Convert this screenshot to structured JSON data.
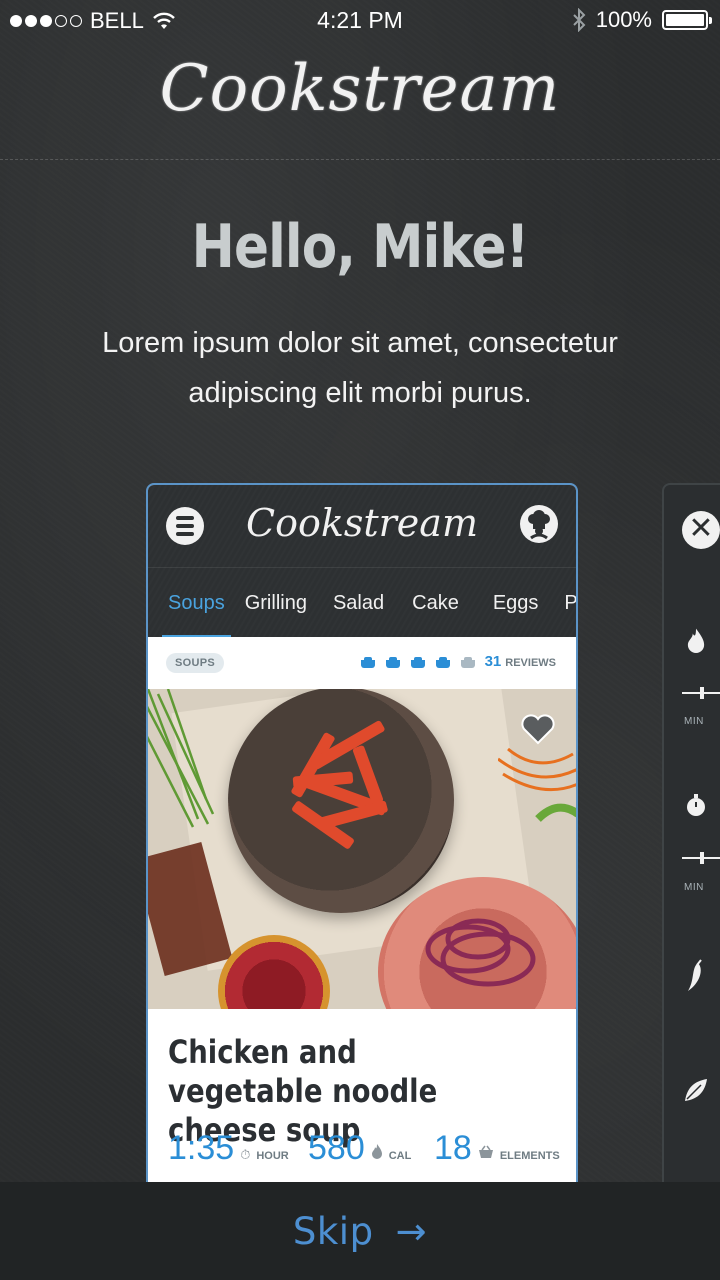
{
  "status_bar": {
    "carrier": "BELL",
    "time": "4:21 PM",
    "battery": "100%",
    "signal_bars_filled": 3,
    "signal_bars_total": 5
  },
  "app": {
    "logo": "Cookstream"
  },
  "greeting": {
    "title": "Hello, Mike!",
    "text": "Lorem ipsum dolor sit amet, consectetur adipiscing elit morbi purus."
  },
  "card": {
    "logo": "Cookstream",
    "tabs": [
      "Soups",
      "Grilling",
      "Salad",
      "Cake",
      "Eggs",
      "Pi"
    ],
    "active_tab": "Soups",
    "category_badge": "SOUPS",
    "rating": 4,
    "rating_max": 5,
    "reviews_count": "31",
    "reviews_label": "REVIEWS",
    "recipe_title": "Chicken and vegetable noodle cheese soup",
    "stats": [
      {
        "value": "1:35",
        "unit": "HOUR",
        "icon": "timer-icon"
      },
      {
        "value": "580",
        "unit": "CAL",
        "icon": "flame-icon"
      },
      {
        "value": "18",
        "unit": "ELEMENTS",
        "icon": "basket-icon"
      }
    ]
  },
  "side_panel": {
    "min_label_1": "MIN",
    "min_label_2": "MIN"
  },
  "skip": {
    "label": "Skip",
    "arrow": "→"
  },
  "colors": {
    "accent": "#4aa3df",
    "skip": "#4d8fd1",
    "background": "#2b2d2e"
  }
}
